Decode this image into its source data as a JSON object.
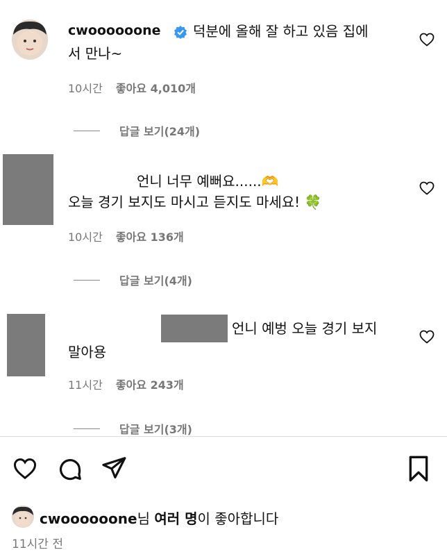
{
  "comments": [
    {
      "username": "cwoooooone",
      "text_line1": "덕분에 올해 잘 하고 있음 집에",
      "text_line2": "서 만나~",
      "time": "10시간",
      "likes": "좋아요 4,010개",
      "replies": "답글 보기(24개)"
    },
    {
      "text_line1": "언니 너무 예뻐요......🫶",
      "text_line2": "오늘 경기 보지도 마시고 듣지도 마세요! 🍀",
      "time": "10시간",
      "likes": "좋아요 136개",
      "replies": "답글 보기(4개)"
    },
    {
      "text_line1": "언니 예벙 오늘 경기 보지",
      "text_line2": "말아용",
      "time": "11시간",
      "likes": "좋아요 243개",
      "replies": "답글 보기(3개)"
    }
  ],
  "footer": {
    "liked_by_user": "cwoooooone",
    "liked_by_mid": "님 ",
    "liked_by_others": "여러 명",
    "liked_by_suffix": "이 좋아합니다",
    "time": "11시간 전"
  },
  "icons": {
    "like": "heart-icon",
    "comment": "comment-bubble-icon",
    "share": "paper-plane-icon",
    "save": "bookmark-icon",
    "verified": "verified-badge-icon"
  },
  "colors": {
    "verified_blue": "#3897f0",
    "muted_gray": "#777777"
  }
}
